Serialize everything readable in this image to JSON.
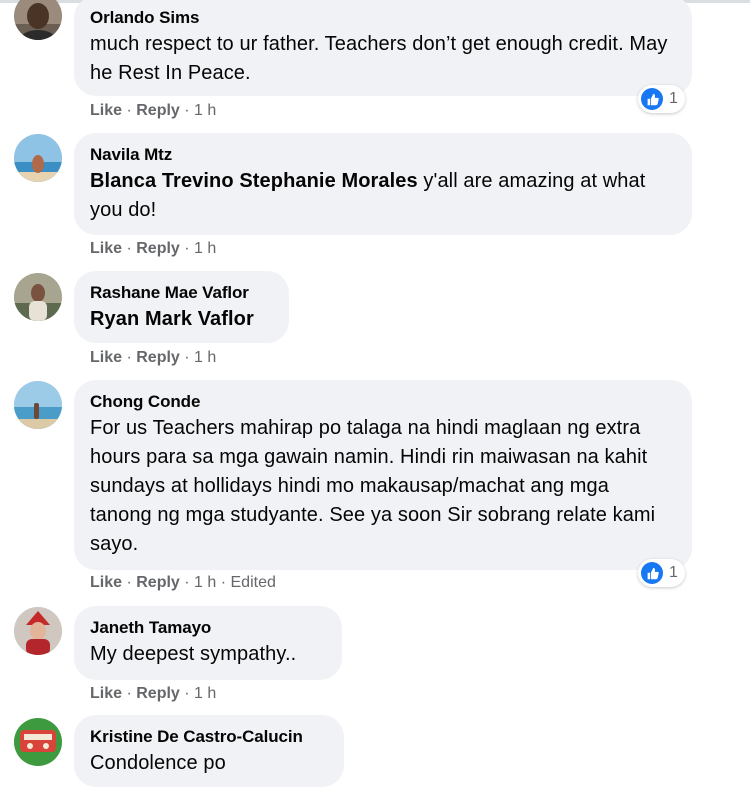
{
  "comments": [
    {
      "author": "Orlando Sims",
      "text": "much respect to ur father. Teachers don’t get enough credit. May he Rest In Peace.",
      "like": "Like",
      "reply": "Reply",
      "time": "1 h",
      "reactions": "1"
    },
    {
      "author": "Navila Mtz",
      "tags": "Blanca Trevino Stephanie Morales",
      "text": " y'all are amazing at what you do!",
      "like": "Like",
      "reply": "Reply",
      "time": "1 h"
    },
    {
      "author": "Rashane Mae Vaflor",
      "tags": "Ryan Mark Vaflor",
      "like": "Like",
      "reply": "Reply",
      "time": "1 h"
    },
    {
      "author": "Chong Conde",
      "text": "For us Teachers mahirap po talaga na hindi maglaan ng extra hours para sa mga gawain namin. Hindi rin maiwasan na kahit sundays at hollidays hindi mo makausap/machat ang mga tanong ng mga studyante. See ya soon Sir sobrang relate kami sayo.",
      "like": "Like",
      "reply": "Reply",
      "time": "1 h",
      "edited": "Edited",
      "reactions": "1"
    },
    {
      "author": "Janeth Tamayo",
      "text": "My deepest sympathy..",
      "like": "Like",
      "reply": "Reply",
      "time": "1 h"
    },
    {
      "author": "Kristine De Castro-Calucin",
      "text": "Condolence po"
    }
  ],
  "icons": {
    "reaction": "like-thumbs-up-icon",
    "avatar": "profile-photo"
  },
  "colors": {
    "bubble": "#f0f2f5",
    "secondary_text": "#65676b",
    "like_blue": "#1877f2"
  }
}
